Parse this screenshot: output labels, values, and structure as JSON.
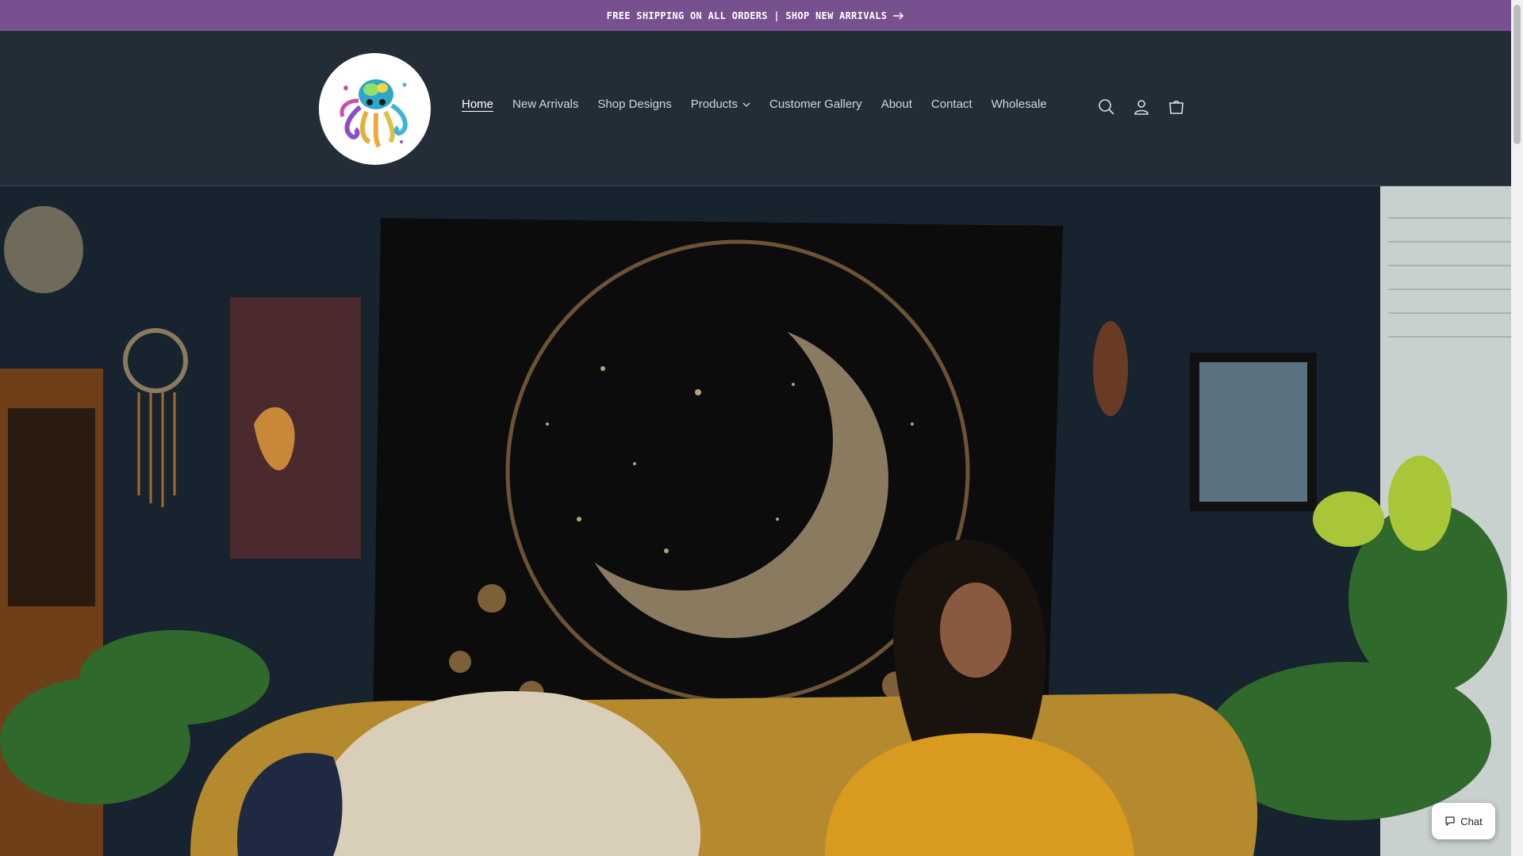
{
  "announcement": {
    "text": "FREE SHIPPING ON ALL ORDERS | SHOP NEW ARRIVALS",
    "icon": "arrow-right-icon"
  },
  "header": {
    "logo_icon": "octopus-logo",
    "nav": [
      {
        "label": "Home",
        "active": true
      },
      {
        "label": "New Arrivals"
      },
      {
        "label": "Shop Designs"
      },
      {
        "label": "Products",
        "has_dropdown": true
      },
      {
        "label": "Customer Gallery"
      },
      {
        "label": "About"
      },
      {
        "label": "Contact"
      },
      {
        "label": "Wholesale"
      }
    ],
    "icons": [
      "search-icon",
      "account-icon",
      "cart-icon"
    ]
  },
  "chat": {
    "label": "Chat",
    "icon": "chat-bubble-icon"
  },
  "colors": {
    "announcement_bg": "#77518f",
    "header_bg": "#232d38",
    "nav_text": "#cfd5dc"
  }
}
